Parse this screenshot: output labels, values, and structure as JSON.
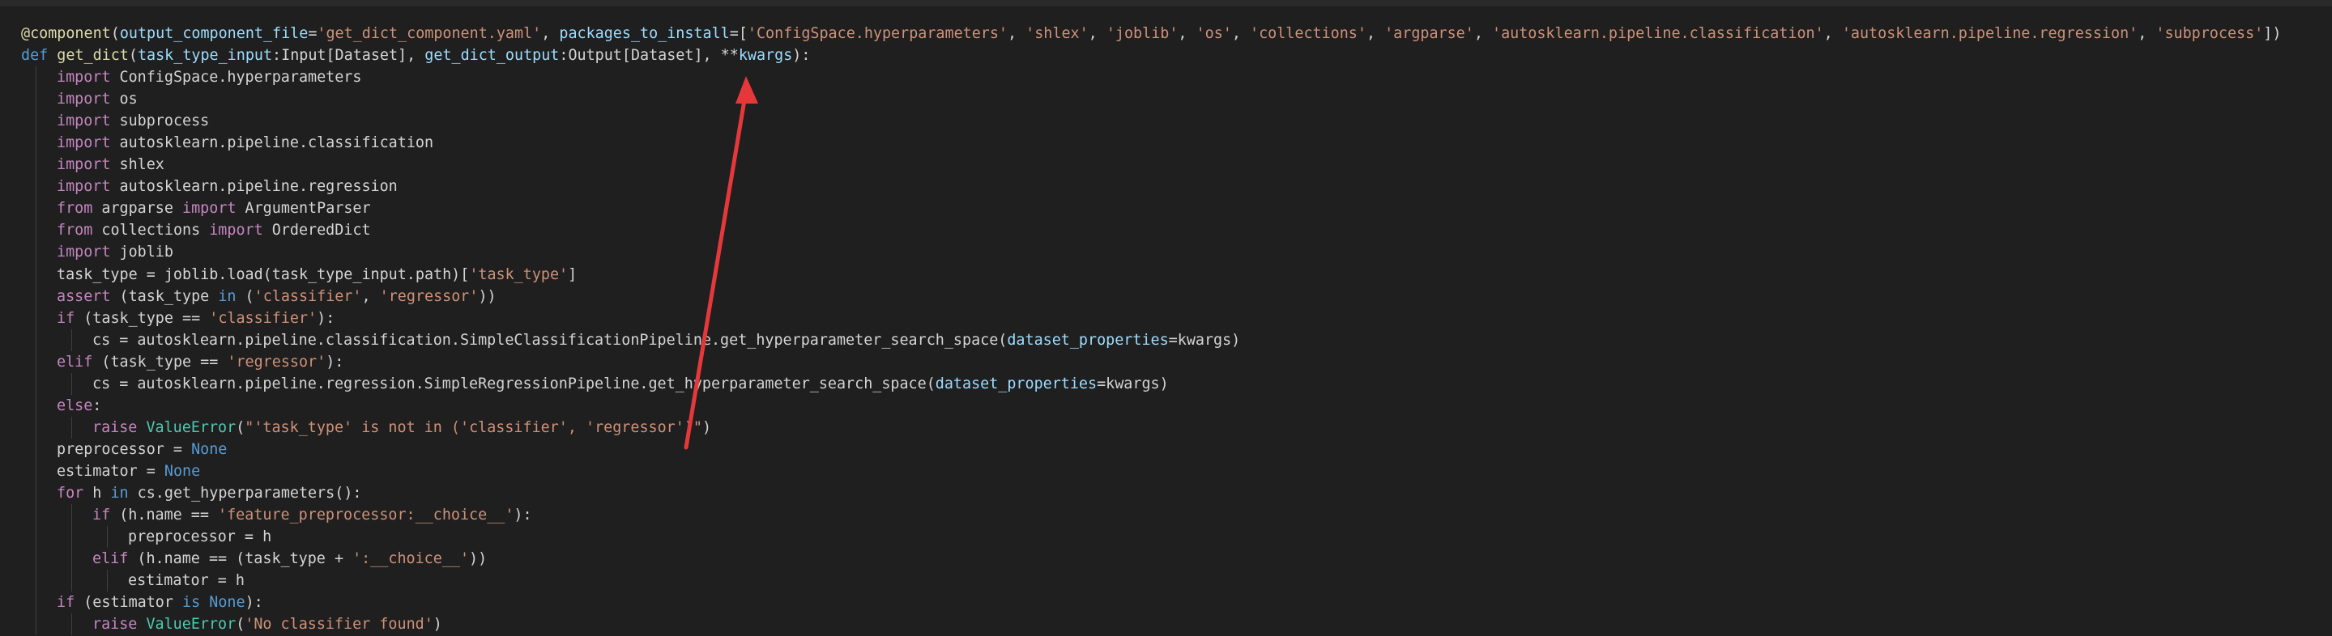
{
  "editor": {
    "background": "#1f1f1f",
    "colors": {
      "keyword": "#c586c0",
      "def": "#569cd6",
      "function": "#dcdcaa",
      "string": "#ce9178",
      "parameter": "#9cdcfe",
      "constant": "#569cd6",
      "class": "#4ec9b0",
      "plain": "#d4d4d4",
      "annotation_arrow": "#e5383b"
    },
    "lines": [
      {
        "indent": 0,
        "tokens": [
          [
            "dec",
            "@component"
          ],
          [
            "plain",
            "("
          ],
          [
            "param",
            "output_component_file"
          ],
          [
            "plain",
            "="
          ],
          [
            "str",
            "'get_dict_component.yaml'"
          ],
          [
            "plain",
            ", "
          ],
          [
            "param",
            "packages_to_install"
          ],
          [
            "plain",
            "=["
          ],
          [
            "str",
            "'ConfigSpace.hyperparameters'"
          ],
          [
            "plain",
            ", "
          ],
          [
            "str",
            "'shlex'"
          ],
          [
            "plain",
            ", "
          ],
          [
            "str",
            "'joblib'"
          ],
          [
            "plain",
            ", "
          ],
          [
            "str",
            "'os'"
          ],
          [
            "plain",
            ", "
          ],
          [
            "str",
            "'collections'"
          ],
          [
            "plain",
            ", "
          ],
          [
            "str",
            "'argparse'"
          ],
          [
            "plain",
            ", "
          ],
          [
            "str",
            "'autosklearn.pipeline.classification'"
          ],
          [
            "plain",
            ", "
          ],
          [
            "str",
            "'autosklearn.pipeline.regression'"
          ],
          [
            "plain",
            ", "
          ],
          [
            "str",
            "'subprocess'"
          ],
          [
            "plain",
            "])"
          ]
        ]
      },
      {
        "indent": 0,
        "tokens": [
          [
            "def",
            "def "
          ],
          [
            "fn",
            "get_dict"
          ],
          [
            "plain",
            "("
          ],
          [
            "param",
            "task_type_input"
          ],
          [
            "plain",
            ":Input[Dataset], "
          ],
          [
            "param",
            "get_dict_output"
          ],
          [
            "plain",
            ":Output[Dataset], **"
          ],
          [
            "param",
            "kwargs"
          ],
          [
            "plain",
            "):"
          ]
        ]
      },
      {
        "indent": 1,
        "tokens": [
          [
            "kw",
            "import"
          ],
          [
            "plain",
            " ConfigSpace.hyperparameters"
          ]
        ]
      },
      {
        "indent": 1,
        "tokens": [
          [
            "kw",
            "import"
          ],
          [
            "plain",
            " os"
          ]
        ]
      },
      {
        "indent": 1,
        "tokens": [
          [
            "kw",
            "import"
          ],
          [
            "plain",
            " subprocess"
          ]
        ]
      },
      {
        "indent": 1,
        "tokens": [
          [
            "kw",
            "import"
          ],
          [
            "plain",
            " autosklearn.pipeline.classification"
          ]
        ]
      },
      {
        "indent": 1,
        "tokens": [
          [
            "kw",
            "import"
          ],
          [
            "plain",
            " shlex"
          ]
        ]
      },
      {
        "indent": 1,
        "tokens": [
          [
            "kw",
            "import"
          ],
          [
            "plain",
            " autosklearn.pipeline.regression"
          ]
        ]
      },
      {
        "indent": 1,
        "tokens": [
          [
            "kw",
            "from"
          ],
          [
            "plain",
            " argparse "
          ],
          [
            "kw",
            "import"
          ],
          [
            "plain",
            " ArgumentParser"
          ]
        ]
      },
      {
        "indent": 1,
        "tokens": [
          [
            "kw",
            "from"
          ],
          [
            "plain",
            " collections "
          ],
          [
            "kw",
            "import"
          ],
          [
            "plain",
            " OrderedDict"
          ]
        ]
      },
      {
        "indent": 1,
        "tokens": [
          [
            "kw",
            "import"
          ],
          [
            "plain",
            " joblib"
          ]
        ]
      },
      {
        "indent": 1,
        "tokens": [
          [
            "plain",
            "task_type = joblib.load(task_type_input.path)["
          ],
          [
            "str",
            "'task_type'"
          ],
          [
            "plain",
            "]"
          ]
        ]
      },
      {
        "indent": 1,
        "tokens": [
          [
            "kw",
            "assert"
          ],
          [
            "plain",
            " (task_type "
          ],
          [
            "def",
            "in"
          ],
          [
            "plain",
            " ("
          ],
          [
            "str",
            "'classifier'"
          ],
          [
            "plain",
            ", "
          ],
          [
            "str",
            "'regressor'"
          ],
          [
            "plain",
            "))"
          ]
        ]
      },
      {
        "indent": 1,
        "tokens": [
          [
            "kw",
            "if"
          ],
          [
            "plain",
            " (task_type == "
          ],
          [
            "str",
            "'classifier'"
          ],
          [
            "plain",
            "):"
          ]
        ]
      },
      {
        "indent": 2,
        "tokens": [
          [
            "plain",
            "cs = autosklearn.pipeline.classification.SimpleClassificationPipeline.get_hyperparameter_search_space("
          ],
          [
            "param",
            "dataset_properties"
          ],
          [
            "plain",
            "=kwargs)"
          ]
        ]
      },
      {
        "indent": 1,
        "tokens": [
          [
            "kw",
            "elif"
          ],
          [
            "plain",
            " (task_type == "
          ],
          [
            "str",
            "'regressor'"
          ],
          [
            "plain",
            "):"
          ]
        ]
      },
      {
        "indent": 2,
        "tokens": [
          [
            "plain",
            "cs = autosklearn.pipeline.regression.SimpleRegressionPipeline.get_hyperparameter_search_space("
          ],
          [
            "param",
            "dataset_properties"
          ],
          [
            "plain",
            "=kwargs)"
          ]
        ]
      },
      {
        "indent": 1,
        "tokens": [
          [
            "kw",
            "else"
          ],
          [
            "plain",
            ":"
          ]
        ]
      },
      {
        "indent": 2,
        "tokens": [
          [
            "kw",
            "raise"
          ],
          [
            "plain",
            " "
          ],
          [
            "cls",
            "ValueError"
          ],
          [
            "plain",
            "("
          ],
          [
            "str",
            "\"'task_type' is not in ('classifier', 'regressor')\""
          ],
          [
            "plain",
            ")"
          ]
        ]
      },
      {
        "indent": 1,
        "tokens": [
          [
            "plain",
            "preprocessor = "
          ],
          [
            "const",
            "None"
          ]
        ]
      },
      {
        "indent": 1,
        "tokens": [
          [
            "plain",
            "estimator = "
          ],
          [
            "const",
            "None"
          ]
        ]
      },
      {
        "indent": 1,
        "tokens": [
          [
            "kw",
            "for"
          ],
          [
            "plain",
            " h "
          ],
          [
            "def",
            "in"
          ],
          [
            "plain",
            " cs.get_hyperparameters():"
          ]
        ]
      },
      {
        "indent": 2,
        "tokens": [
          [
            "kw",
            "if"
          ],
          [
            "plain",
            " (h.name == "
          ],
          [
            "str",
            "'feature_preprocessor:__choice__'"
          ],
          [
            "plain",
            "):"
          ]
        ]
      },
      {
        "indent": 3,
        "tokens": [
          [
            "plain",
            "preprocessor = h"
          ]
        ]
      },
      {
        "indent": 2,
        "tokens": [
          [
            "kw",
            "elif"
          ],
          [
            "plain",
            " (h.name == (task_type + "
          ],
          [
            "str",
            "':__choice__'"
          ],
          [
            "plain",
            "))"
          ]
        ]
      },
      {
        "indent": 3,
        "tokens": [
          [
            "plain",
            "estimator = h"
          ]
        ]
      },
      {
        "indent": 1,
        "tokens": [
          [
            "kw",
            "if"
          ],
          [
            "plain",
            " (estimator "
          ],
          [
            "def",
            "is"
          ],
          [
            "plain",
            " "
          ],
          [
            "const",
            "None"
          ],
          [
            "plain",
            "):"
          ]
        ]
      },
      {
        "indent": 2,
        "tokens": [
          [
            "kw",
            "raise"
          ],
          [
            "plain",
            " "
          ],
          [
            "cls",
            "ValueError"
          ],
          [
            "plain",
            "("
          ],
          [
            "str",
            "'No classifier found'"
          ],
          [
            "plain",
            ")"
          ]
        ]
      }
    ]
  }
}
